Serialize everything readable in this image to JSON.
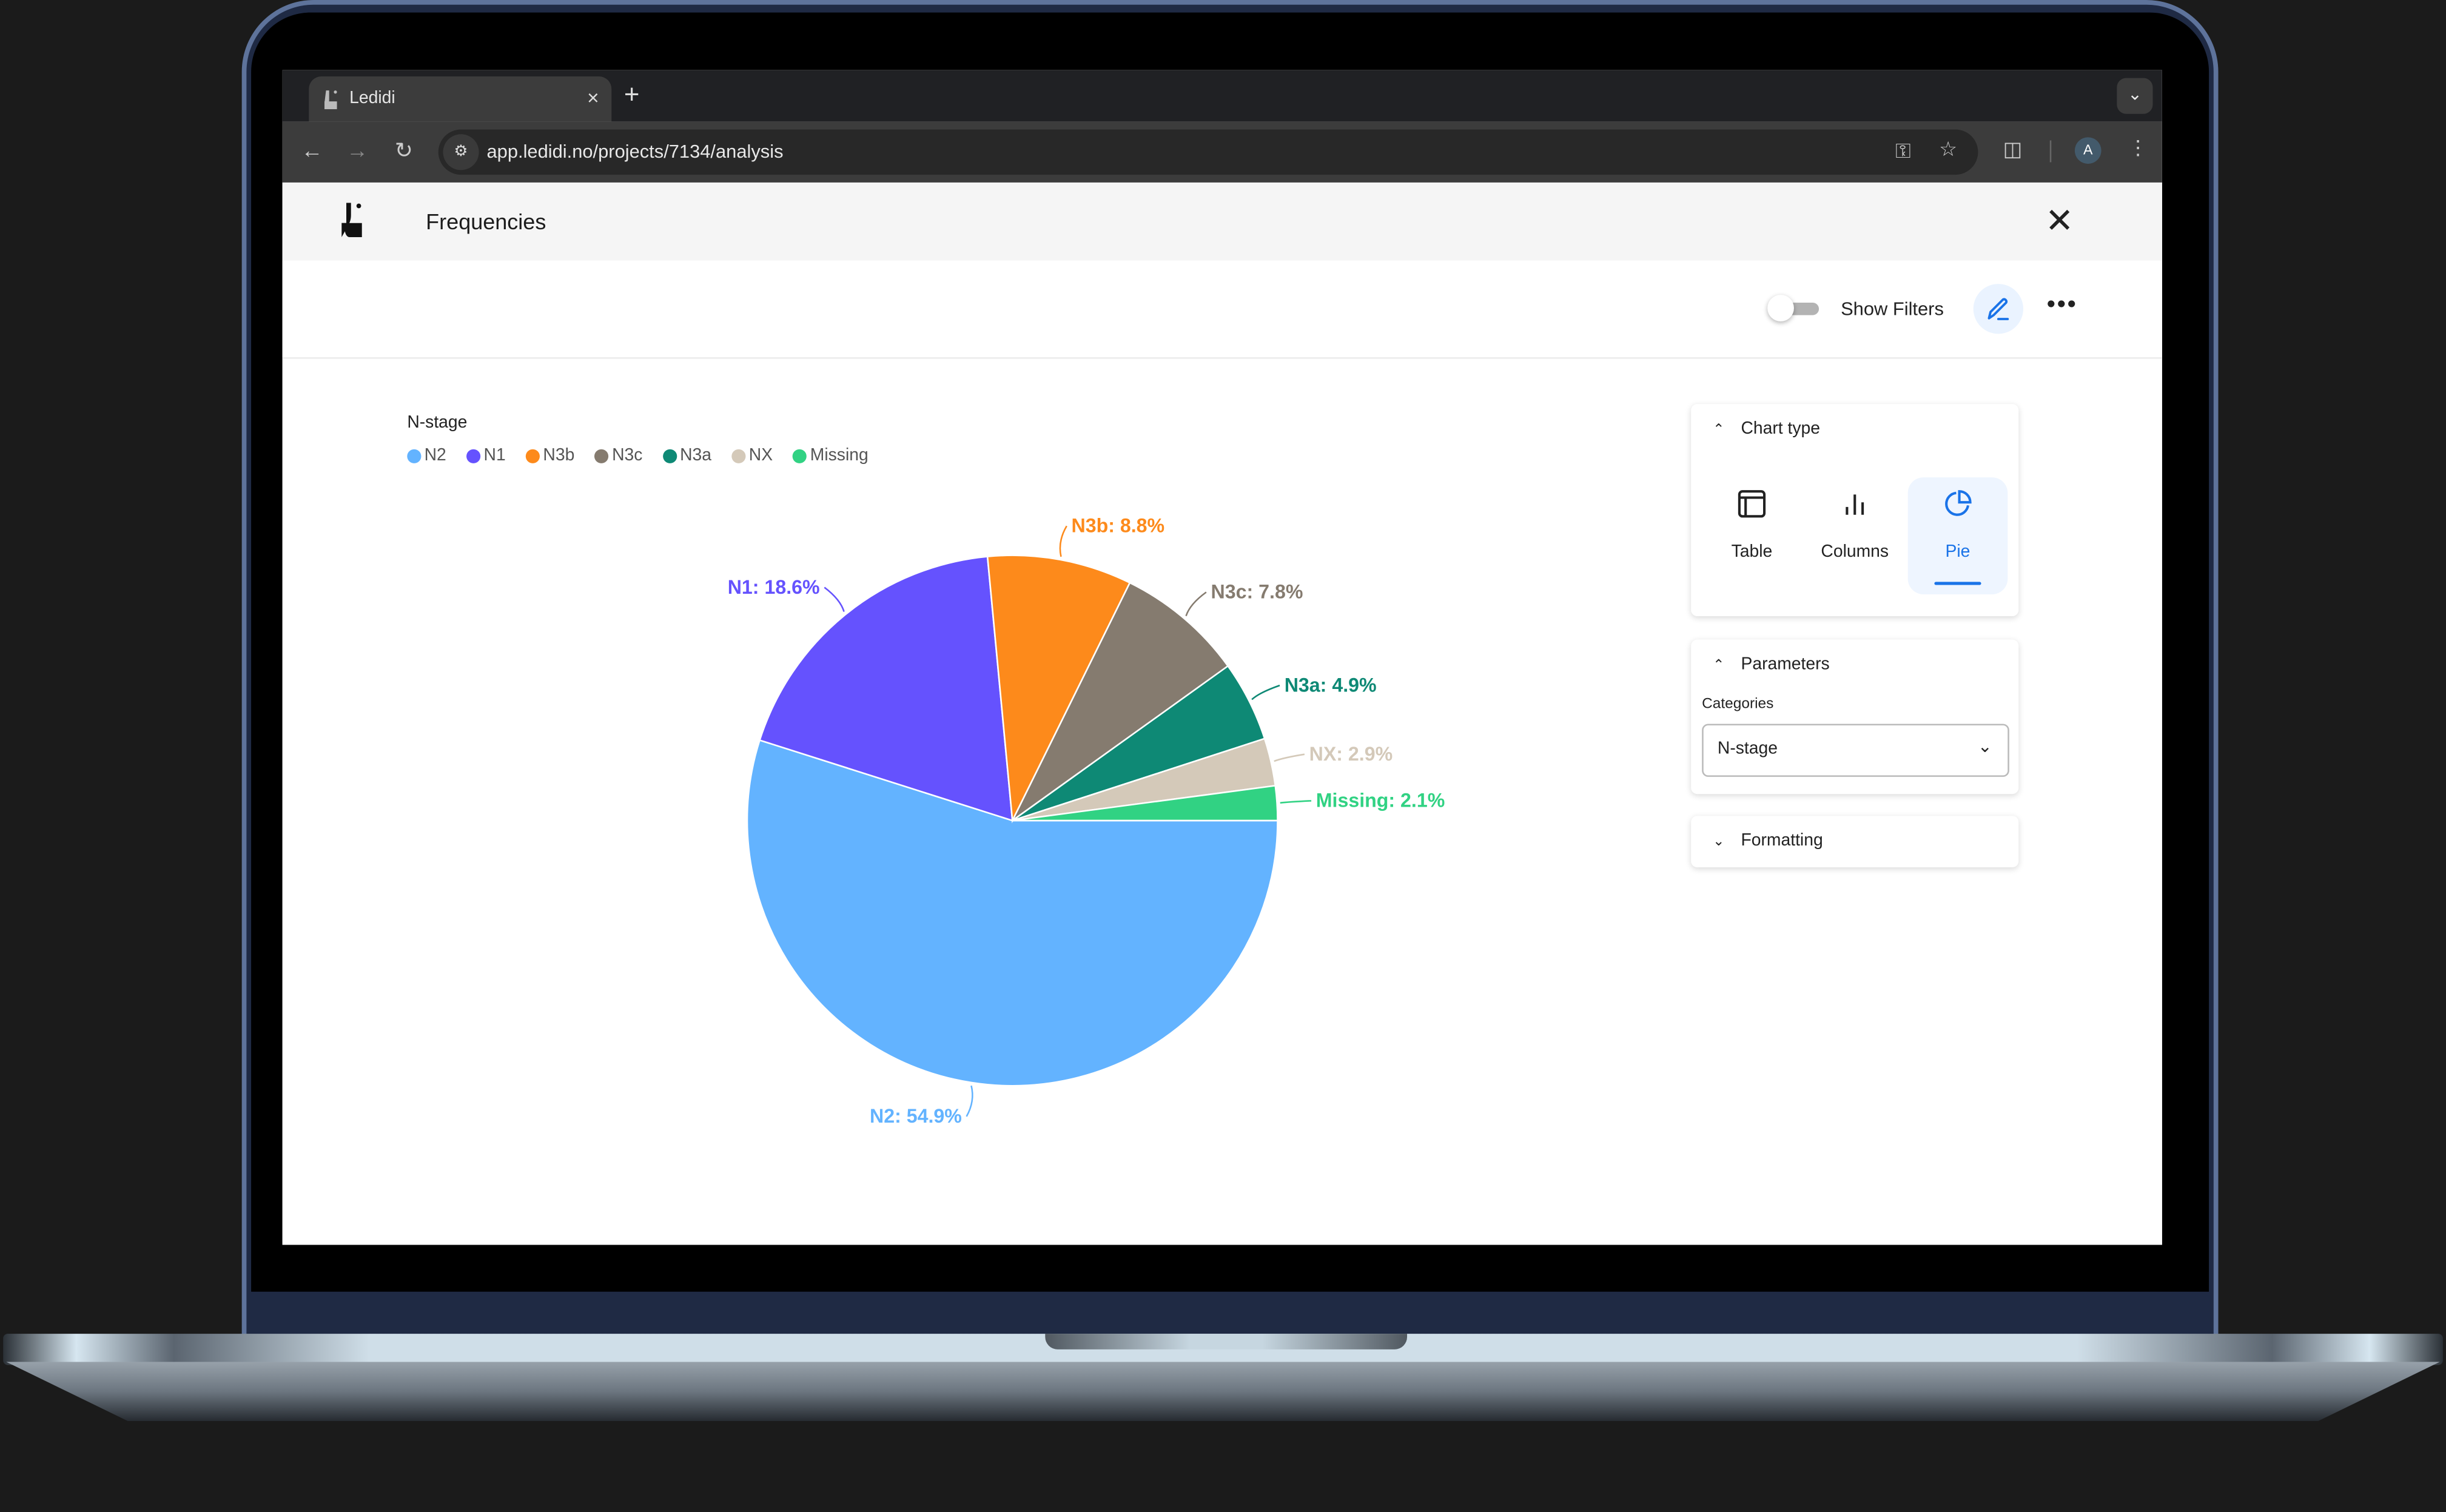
{
  "browser": {
    "tab_title": "Ledidi",
    "tab_close": "×",
    "new_tab": "+",
    "url": "app.ledidi.no/projects/7134/analysis",
    "avatar_initial": "A"
  },
  "app": {
    "title": "Frequencies",
    "show_filters_label": "Show Filters",
    "show_filters_on": false
  },
  "side_panel": {
    "chart_type": {
      "header": "Chart type",
      "expanded": true,
      "options": [
        {
          "label": "Table",
          "icon": "table-icon",
          "active": false
        },
        {
          "label": "Columns",
          "icon": "bar-chart-icon",
          "active": false
        },
        {
          "label": "Pie",
          "icon": "pie-chart-icon",
          "active": true
        }
      ]
    },
    "parameters": {
      "header": "Parameters",
      "expanded": true,
      "categories_label": "Categories",
      "categories_value": "N-stage"
    },
    "formatting": {
      "header": "Formatting",
      "expanded": false
    }
  },
  "colors": {
    "accent": "#1a73e8",
    "edit_bg": "#eaf3ff"
  },
  "chart_data": {
    "type": "pie",
    "title": "",
    "legend_title": "N-stage",
    "legend_position": "top-left",
    "categories": [
      "N2",
      "N1",
      "N3b",
      "N3c",
      "N3a",
      "NX",
      "Missing"
    ],
    "values": [
      54.9,
      18.6,
      8.8,
      7.8,
      4.9,
      2.9,
      2.1
    ],
    "unit": "%",
    "colors": [
      "#63b3ff",
      "#6552fe",
      "#fd8a1b",
      "#857b6f",
      "#0e8975",
      "#d4c9b9",
      "#31d283"
    ],
    "labels": [
      "N2: 54.9%",
      "N1: 18.6%",
      "N3b: 8.8%",
      "N3c: 7.8%",
      "N3a: 4.9%",
      "NX: 2.9%",
      "Missing: 2.1%"
    ]
  }
}
